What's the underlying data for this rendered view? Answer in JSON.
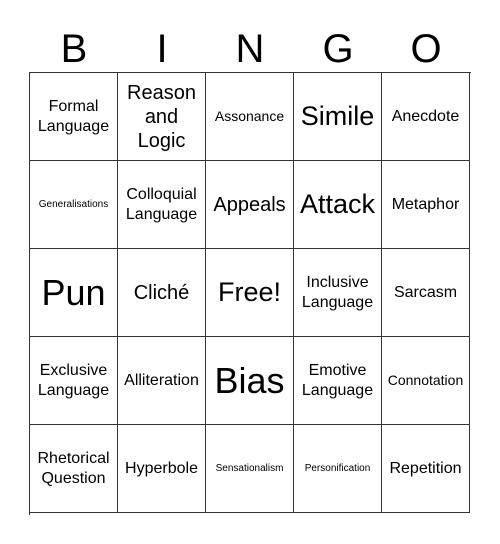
{
  "header": {
    "letters": [
      "B",
      "I",
      "N",
      "G",
      "O"
    ]
  },
  "cells": [
    {
      "text": "Formal Language",
      "size": "m"
    },
    {
      "text": "Reason and Logic",
      "size": "l"
    },
    {
      "text": "Assonance",
      "size": "s"
    },
    {
      "text": "Simile",
      "size": "xl"
    },
    {
      "text": "Anecdote",
      "size": "m"
    },
    {
      "text": "Generalisations",
      "size": "xs"
    },
    {
      "text": "Colloquial Language",
      "size": "m"
    },
    {
      "text": "Appeals",
      "size": "l"
    },
    {
      "text": "Attack",
      "size": "xl"
    },
    {
      "text": "Metaphor",
      "size": "m"
    },
    {
      "text": "Pun",
      "size": "xxl"
    },
    {
      "text": "Cliché",
      "size": "l"
    },
    {
      "text": "Free!",
      "size": "xl"
    },
    {
      "text": "Inclusive Language",
      "size": "m"
    },
    {
      "text": "Sarcasm",
      "size": "m"
    },
    {
      "text": "Exclusive Language",
      "size": "m"
    },
    {
      "text": "Alliteration",
      "size": "m"
    },
    {
      "text": "Bias",
      "size": "xxl"
    },
    {
      "text": "Emotive Language",
      "size": "m"
    },
    {
      "text": "Connotation",
      "size": "s"
    },
    {
      "text": "Rhetorical Question",
      "size": "m"
    },
    {
      "text": "Hyperbole",
      "size": "m"
    },
    {
      "text": "Sensationalism",
      "size": "xs"
    },
    {
      "text": "Personification",
      "size": "xs"
    },
    {
      "text": "Repetition",
      "size": "m"
    }
  ]
}
